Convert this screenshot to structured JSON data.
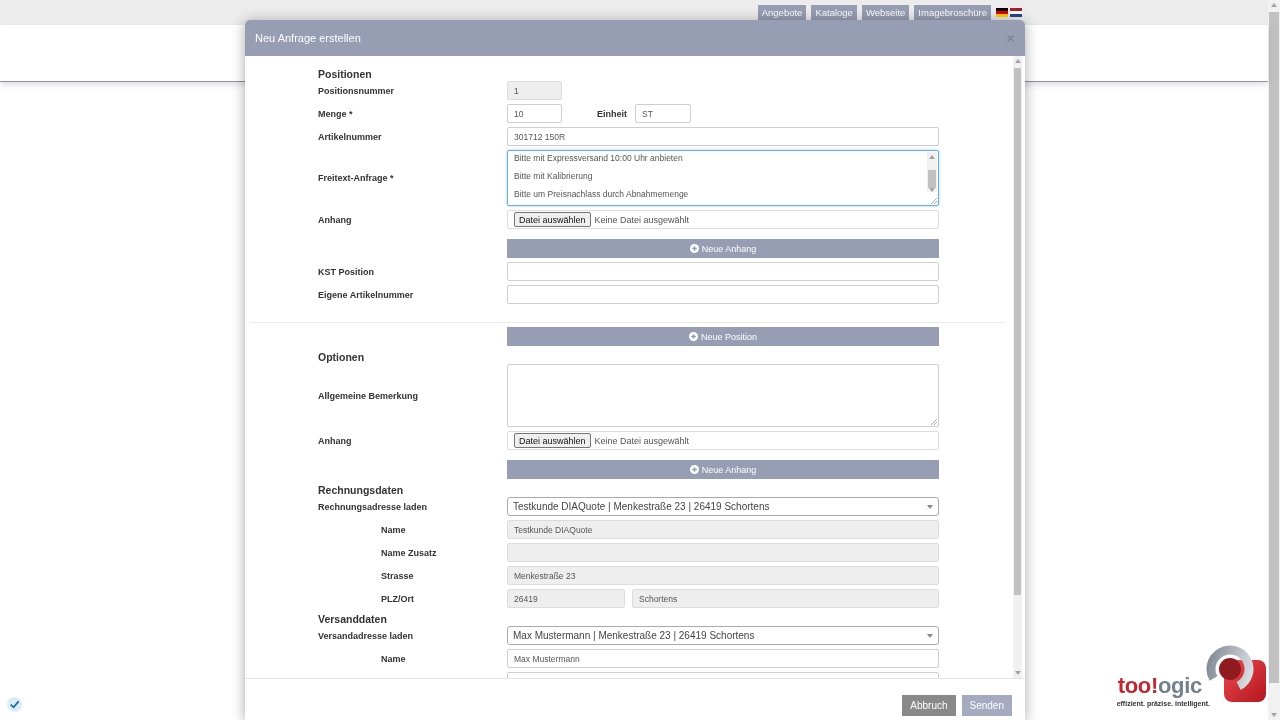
{
  "top_nav": {
    "links": [
      "Angebote",
      "Kataloge",
      "Webseite",
      "Imagebroschüre"
    ],
    "flags": [
      {
        "kind": "de"
      },
      {
        "kind": "nl"
      }
    ]
  },
  "dialog": {
    "title": "Neu Anfrage erstellen",
    "rows": [
      {
        "kind": "heading",
        "text": "Positionen"
      },
      {
        "kind": "short",
        "label": "Positionsnummer",
        "value": "1",
        "disabled": true
      },
      {
        "kind": "quantity",
        "label": "Menge *",
        "value": "10",
        "unit_label": "Einheit",
        "unit_value": "ST"
      },
      {
        "kind": "input",
        "label": "Artikelnummer",
        "value": "301712 150R",
        "disabled": false
      },
      {
        "kind": "textarea",
        "label": "Freitext-Anfrage *",
        "lines": [
          "Bitte mit Expressversand 10:00 Uhr anbieten",
          "Bitte mit Kalibrierung",
          "Bitte um Preisnachlass durch Abnahmemenge"
        ],
        "focused": true
      },
      {
        "kind": "file",
        "label": "Anhang",
        "button": "Datei auswählen",
        "status": "Keine Datei ausgewählt"
      },
      {
        "kind": "action",
        "label": "Neue Anhang"
      },
      {
        "kind": "input",
        "label": "KST Position",
        "disabled": false
      },
      {
        "kind": "input",
        "label": "Eigene Artikelnummer",
        "disabled": false
      },
      {
        "kind": "divider"
      },
      {
        "kind": "action",
        "label": "Neue Position"
      },
      {
        "kind": "heading",
        "text": "Optionen"
      },
      {
        "kind": "textarea",
        "label": "Allgemeine Bemerkung",
        "focused": false
      },
      {
        "kind": "file",
        "label": "Anhang",
        "button": "Datei auswählen",
        "status": "Keine Datei ausgewählt"
      },
      {
        "kind": "action",
        "label": "Neue Anhang"
      },
      {
        "kind": "heading",
        "text": "Rechnungsdaten"
      },
      {
        "kind": "select",
        "label": "Rechnungsadresse laden",
        "value": "Testkunde DIAQuote | Menkestraße 23 | 26419 Schortens",
        "children": [
          {
            "kind": "input",
            "label": "Name",
            "value": "Testkunde DIAQuote",
            "disabled": true
          },
          {
            "kind": "input",
            "label": "Name Zusatz",
            "disabled": true
          },
          {
            "kind": "input",
            "label": "Strasse",
            "value": "Menkestraße 23",
            "disabled": true
          },
          {
            "kind": "split",
            "label": "PLZ/Ort",
            "values": [
              "26419",
              "Schortens"
            ],
            "disabled": true
          }
        ]
      },
      {
        "kind": "heading",
        "text": "Versanddaten"
      },
      {
        "kind": "select",
        "label": "Versandadresse laden",
        "value": "Max Mustermann | Menkestraße 23 | 26419 Schortens",
        "children": [
          {
            "kind": "input",
            "label": "Name",
            "value": "Max Mustermann",
            "disabled": false
          },
          {
            "kind": "input",
            "disabled": false
          }
        ]
      }
    ],
    "buttons": [
      {
        "kind": "cancel",
        "label": "Abbruch"
      },
      {
        "kind": "submit",
        "label": "Senden"
      }
    ]
  },
  "logo": {
    "wordmark": [
      {
        "text": "too!",
        "color": "#c4262e"
      },
      {
        "text": "ogic",
        "color": "#74808b"
      }
    ],
    "tagline": "effizient. präzise. intelligent."
  }
}
